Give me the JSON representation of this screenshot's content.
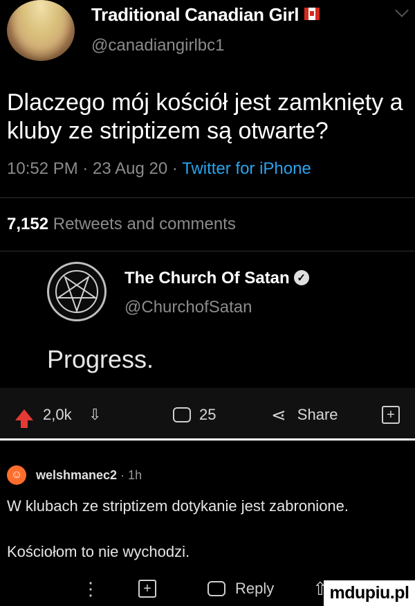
{
  "tweet": {
    "author_name": "Traditional Canadian Girl",
    "author_handle": "@canadiangirlbc1",
    "text": "Dlaczego mój kościół jest zamknięty a kluby ze striptizem są otwarte?",
    "time": "10:52 PM · 23 Aug 20 · ",
    "source": "Twitter for iPhone",
    "stats_count": "7,152",
    "stats_label": " Retweets and comments",
    "flag_icon": "canada-flag-icon"
  },
  "quoted": {
    "author_name": "The Church Of Satan",
    "author_handle": "@ChurchofSatan",
    "text": "Progress."
  },
  "post_actions": {
    "upvotes": "2,0k",
    "comments": "25",
    "share_label": "Share"
  },
  "comment": {
    "user": "welshmanec2",
    "time": " · 1h",
    "line1": "W klubach ze striptizem dotykanie jest zabronione.",
    "line2": "Kościołom to nie wychodzi.",
    "reply_label": "Reply"
  },
  "watermark": "mdupiu.pl",
  "colors": {
    "upvote": "#e53935",
    "link": "#2aa3ef",
    "background": "#000000"
  }
}
